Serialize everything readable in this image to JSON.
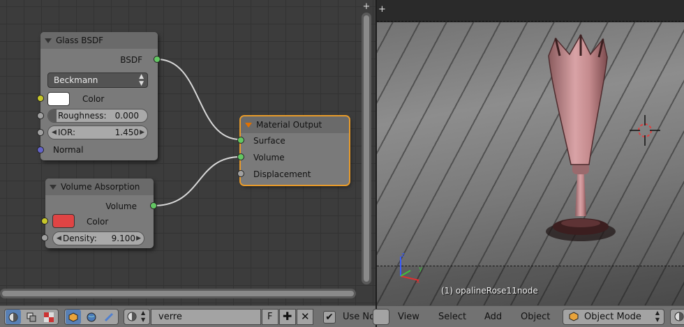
{
  "node_editor": {
    "glass_node": {
      "title": "Glass BSDF",
      "output_label": "BSDF",
      "distribution": "Beckmann",
      "color_label": "Color",
      "color_value": "#ffffff",
      "roughness_label": "Roughness:",
      "roughness_value": "0.000",
      "ior_label": "IOR:",
      "ior_value": "1.450",
      "normal_label": "Normal"
    },
    "volume_node": {
      "title": "Volume Absorption",
      "output_label": "Volume",
      "color_label": "Color",
      "color_value": "#e04444",
      "density_label": "Density:",
      "density_value": "9.100"
    },
    "output_node": {
      "title": "Material Output",
      "inputs": [
        "Surface",
        "Volume",
        "Displacement"
      ]
    }
  },
  "viewport": {
    "object_label": "(1) opalineRose11node"
  },
  "node_header": {
    "material_name": "verre",
    "fake_user_label": "F",
    "use_nodes_label": "Use No",
    "use_nodes_checked": true
  },
  "viewport_header": {
    "menus": [
      "View",
      "Select",
      "Add",
      "Object"
    ],
    "mode": "Object Mode"
  },
  "colors": {
    "socket_shader": "#63c763",
    "socket_color": "#c7c729",
    "socket_value": "#a1a1a1",
    "socket_vector": "#6363c7",
    "selection_outline": "#e89b2a",
    "active_button": "#5880b5"
  }
}
